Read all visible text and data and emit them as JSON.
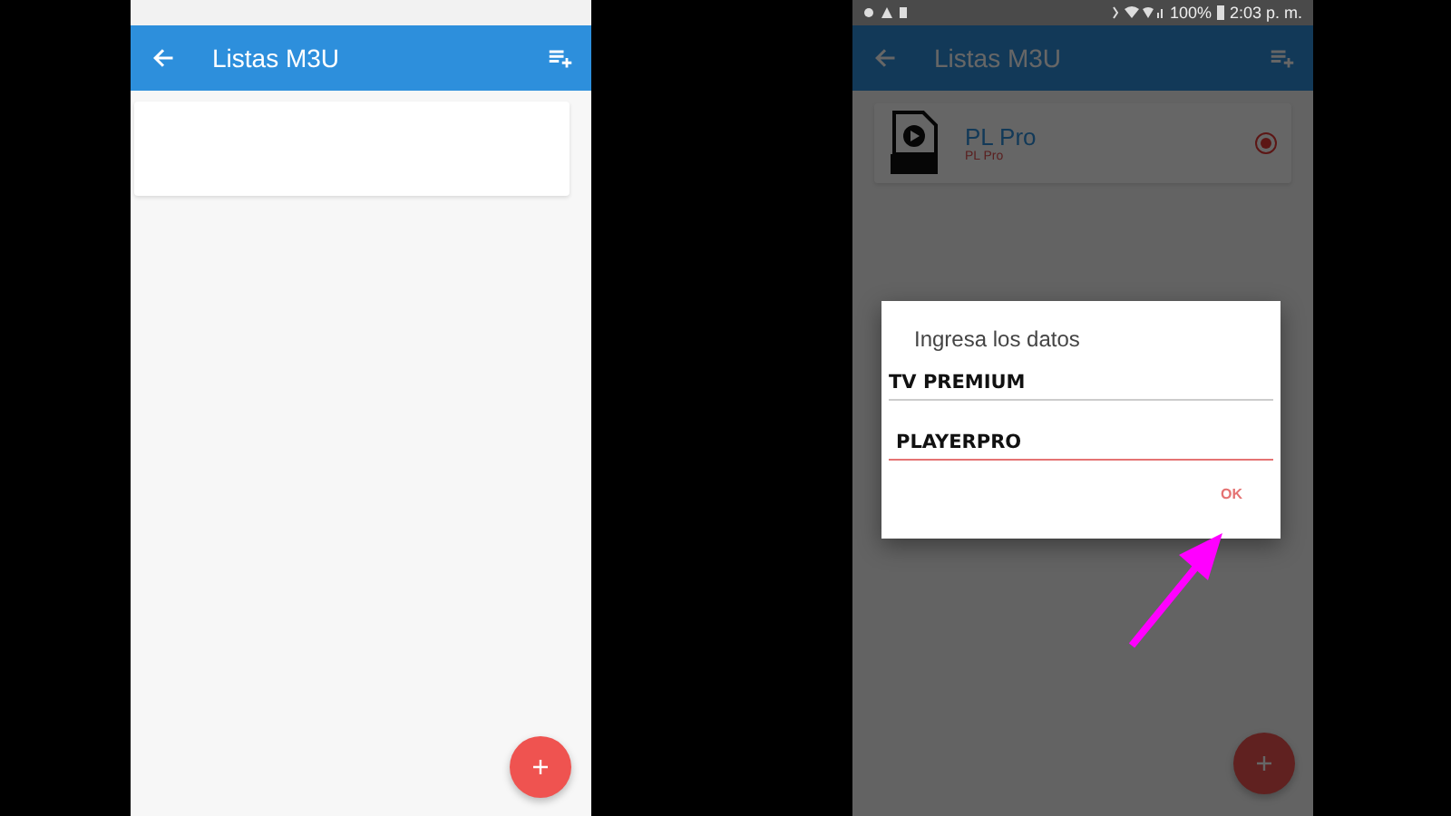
{
  "phones": [
    {
      "app_bar": {
        "title": "Listas M3U"
      }
    },
    {
      "status_bar": {
        "battery": "100%",
        "time": "2:03 p. m."
      },
      "app_bar": {
        "title": "Listas M3U"
      },
      "playlists": [
        {
          "name": "PL Pro",
          "subtitle": "PL Pro",
          "selected": true
        }
      ],
      "dialog": {
        "title": "Ingresa los datos",
        "fields": [
          {
            "value": "TV PREMIUM",
            "focused": false
          },
          {
            "value": "PLAYERPRO",
            "focused": true
          }
        ],
        "ok_button": "OK"
      }
    }
  ]
}
